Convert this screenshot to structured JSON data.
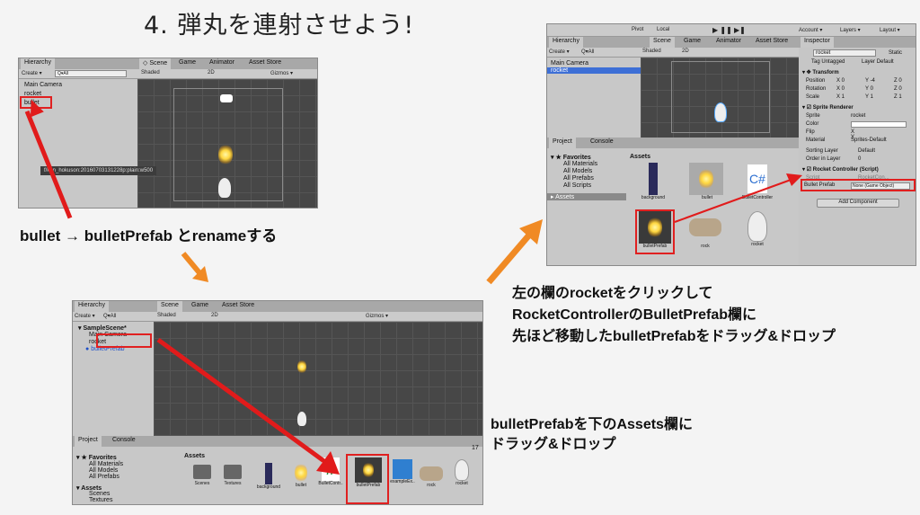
{
  "title": "4. 弾丸を連射させよう!",
  "captions": {
    "rename": "bullet → bulletPrefab とrenameする",
    "drag_assets_1": "bulletPrefabを下のAssets欄に",
    "drag_assets_2": "ドラッグ&ドロップ",
    "click_1": "左の欄のrocketをクリックして",
    "click_2": "RocketControllerのBulletPrefab欄に",
    "click_3": "先ほど移動したbulletPrefabをドラッグ&ドロップ"
  },
  "colors": {
    "accent_red": "#e11b1b",
    "arrow_orange": "#f08a24"
  },
  "panel1": {
    "hierarchy_tab": "Hierarchy",
    "create": "Create ▾",
    "search": "Q▾All",
    "items": [
      "Main Camera",
      "rocket",
      "bullet"
    ],
    "scene_tabs": [
      "Scene",
      "Game",
      "Animator",
      "Asset Store"
    ],
    "shaded": "Shaded",
    "mode2d": "2D",
    "gizmos": "Gizmos ▾",
    "tooltip": "f/kan_hokuson:20160703131228p:plain:w500"
  },
  "panel2": {
    "hierarchy_tab": "Hierarchy",
    "create": "Create ▾",
    "search": "Q▾All",
    "scene_name": "SampleScene*",
    "items": [
      "Main Camera",
      "rocket",
      "bulletPrefab"
    ],
    "scene_tabs": [
      "Scene",
      "Game",
      "Asset Store"
    ],
    "shaded": "Shaded",
    "mode2d": "2D",
    "gizmos": "Gizmos ▾",
    "project_tabs": [
      "Project",
      "Console"
    ],
    "favorites": "Favorites",
    "fav_items": [
      "All Materials",
      "All Models",
      "All Prefabs"
    ],
    "assets": "Assets",
    "asset_folders": [
      "Scenes",
      "Textures"
    ],
    "assets_header": "Assets",
    "asset_items": [
      "Scenes",
      "Textures",
      "background",
      "bullet",
      "BulletContr..",
      "bulletPrefab",
      "exampleEx..",
      "rock",
      "rocket"
    ],
    "count": "17"
  },
  "panel3": {
    "toolbar": {
      "pivot": "Pivot",
      "local": "Local",
      "account": "Account ▾",
      "layers": "Layers ▾",
      "layout": "Layout ▾"
    },
    "hierarchy_tab": "Hierarchy",
    "create": "Create ▾",
    "search": "Q▾All",
    "items": [
      "Main Camera",
      "rocket"
    ],
    "scene_tabs": [
      "Scene",
      "Game",
      "Animator",
      "Asset Store"
    ],
    "shaded": "Shaded",
    "mode2d": "2D",
    "project_tabs": [
      "Project",
      "Console"
    ],
    "favorites": "Favorites",
    "fav_items": [
      "All Materials",
      "All Models",
      "All Prefabs",
      "All Scripts"
    ],
    "assets": "Assets",
    "assets_header": "Assets",
    "asset_items": [
      "background",
      "bullet",
      "BulletController",
      "bulletPrefab",
      "rock",
      "rocket"
    ],
    "inspector": {
      "tab": "Inspector",
      "object": "rocket",
      "static": "Static",
      "tag_label": "Tag",
      "tag": "Untagged",
      "layer_label": "Layer",
      "layer": "Default",
      "transform": "Transform",
      "rows": [
        {
          "label": "Position",
          "x": "0",
          "y": "-4",
          "z": "0"
        },
        {
          "label": "Rotation",
          "x": "0",
          "y": "0",
          "z": "0"
        },
        {
          "label": "Scale",
          "x": "1",
          "y": "1",
          "z": "1"
        }
      ],
      "sprite_renderer": "Sprite Renderer",
      "sprite_label": "Sprite",
      "sprite": "rocket",
      "color_label": "Color",
      "flip_label": "Flip",
      "flip": "X  Y",
      "material_label": "Material",
      "material": "Sprites-Default",
      "sorting_label": "Sorting Layer",
      "sorting": "Default",
      "order_label": "Order in Layer",
      "order": "0",
      "script_comp": "Rocket Controller (Script)",
      "script_label": "Script",
      "script": "RocketCon...",
      "bullet_label": "Bullet Prefab",
      "bullet": "None (Game Object)",
      "add_component": "Add Component"
    }
  }
}
